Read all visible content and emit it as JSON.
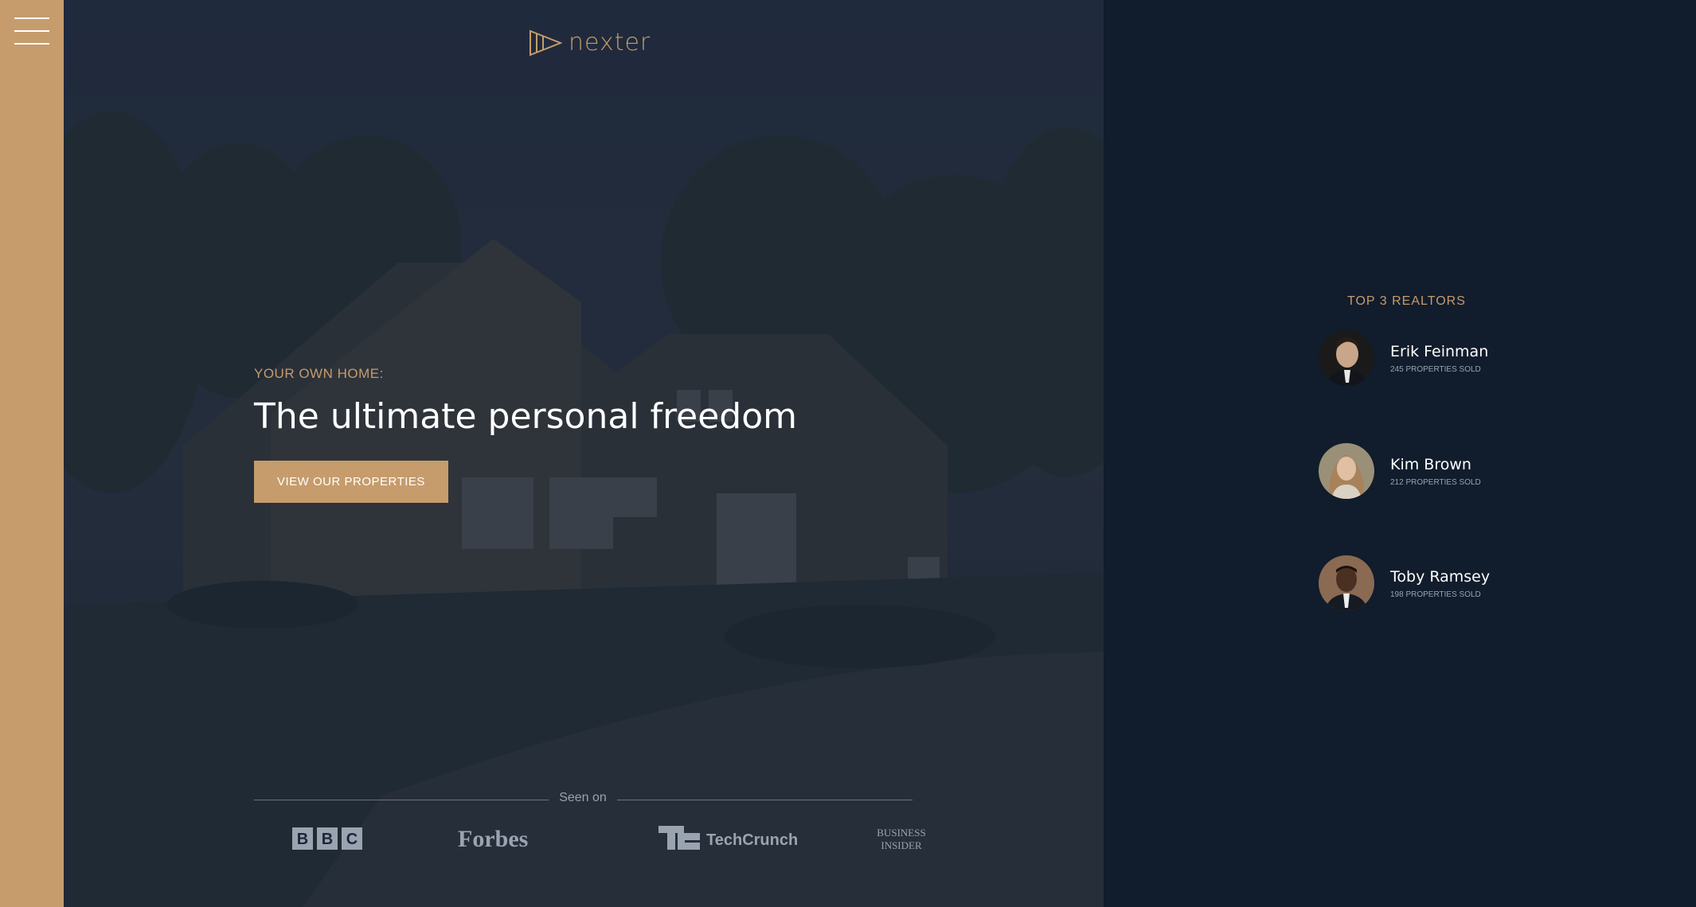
{
  "nav": {
    "menu_icon": "hamburger-menu-icon"
  },
  "brand": {
    "name": "nexter",
    "logo_icon": "play-triangles-logo-icon"
  },
  "hero": {
    "eyebrow": "YOUR OWN HOME:",
    "headline": "The ultimate personal freedom",
    "cta_label": "VIEW OUR PROPERTIES"
  },
  "seen_on": {
    "label": "Seen on",
    "logos": [
      "BBC",
      "Forbes",
      "TechCrunch",
      "Business Insider"
    ]
  },
  "realtors": {
    "title": "TOP 3 REALTORS",
    "items": [
      {
        "name": "Erik Feinman",
        "sold": "245 PROPERTIES SOLD"
      },
      {
        "name": "Kim Brown",
        "sold": "212 PROPERTIES SOLD"
      },
      {
        "name": "Toby Ramsey",
        "sold": "198 PROPERTIES SOLD"
      }
    ]
  },
  "colors": {
    "accent": "#c69c6c",
    "background": "#111c2c",
    "text": "#ffffff",
    "muted": "#9aa3b0"
  }
}
